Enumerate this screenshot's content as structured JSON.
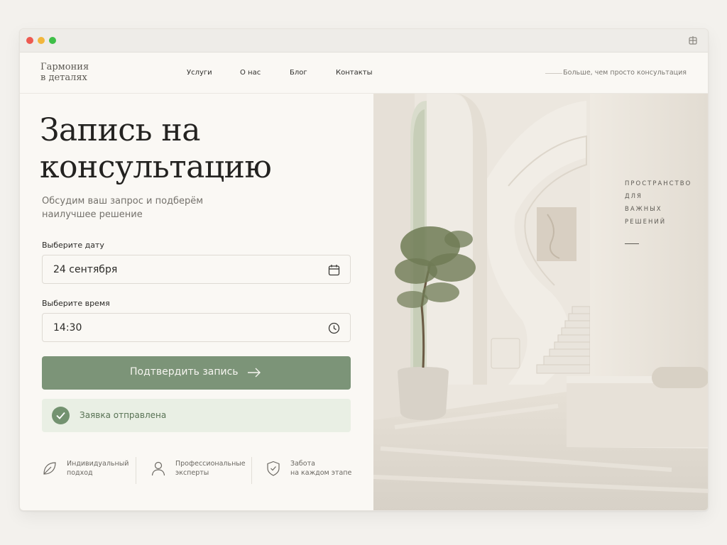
{
  "brand": {
    "line1": "Гармония",
    "line2": "в деталях"
  },
  "nav": [
    {
      "label": "Услуги"
    },
    {
      "label": "О нас"
    },
    {
      "label": "Блог"
    },
    {
      "label": "Контакты"
    }
  ],
  "header": {
    "tagline": "Больше, чем просто консультация"
  },
  "form": {
    "title_line1": "Запись на",
    "title_line2": "консультацию",
    "subtitle": "Обсудим ваш запрос и подберём наилучшее решение",
    "date_label": "Выберите дату",
    "date_value": "24 сентября",
    "time_label": "Выберите время",
    "time_value": "14:30",
    "submit_label": "Подтвердить запись",
    "success_text": "Заявка отправлена"
  },
  "features": [
    {
      "icon": "leaf-icon",
      "line1": "Индивидуальный",
      "line2": "подход"
    },
    {
      "icon": "user-icon",
      "line1": "Профессиональные",
      "line2": "эксперты"
    },
    {
      "icon": "shield-check-icon",
      "line1": "Забота",
      "line2": "на каждом этапе"
    }
  ],
  "hero": {
    "overlay_lines": [
      "ПРОСТРАНСТВО",
      "ДЛЯ",
      "ВАЖНЫХ",
      "РЕШЕНИЙ"
    ]
  },
  "colors": {
    "accent": "#7c9478",
    "success_bg": "#e9efe4",
    "success_text": "#587254",
    "page_bg": "#faf8f4"
  }
}
